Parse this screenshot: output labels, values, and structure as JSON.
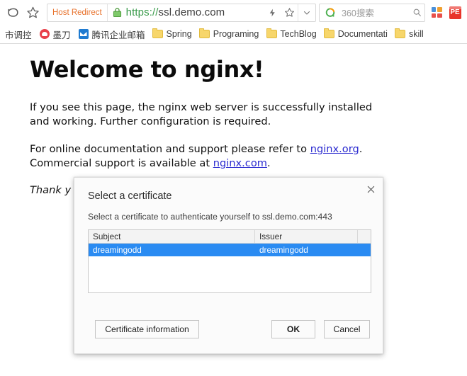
{
  "browser": {
    "toolbar": {
      "back_icon": "back-arrow-icon",
      "bookmark_star_icon": "star-icon",
      "host_redirect_badge": "Host Redirect",
      "lock_icon": "lock-icon",
      "url_scheme": "https://",
      "url_host": "ssl.demo.com",
      "lightning_icon": "lightning-bolt-icon",
      "star_icon": "star-outline-icon",
      "chevron_icon": "chevron-down-icon",
      "search_engine_icon": "360-search-icon",
      "search_placeholder": "360搜索",
      "search_go_icon": "search-icon",
      "ext_grid_icon": "apps-grid-icon",
      "ext_pe_label": "PE"
    },
    "bookmarks": [
      {
        "label": "市调控",
        "icon": "none"
      },
      {
        "label": "墨刀",
        "icon": "modao-icon"
      },
      {
        "label": "腾讯企业邮箱",
        "icon": "tencent-mail-icon"
      },
      {
        "label": "Spring",
        "icon": "folder-icon"
      },
      {
        "label": "Programing",
        "icon": "folder-icon"
      },
      {
        "label": "TechBlog",
        "icon": "folder-icon"
      },
      {
        "label": "Documentati",
        "icon": "folder-icon"
      },
      {
        "label": "skill",
        "icon": "folder-icon"
      }
    ]
  },
  "page": {
    "heading": "Welcome to nginx!",
    "para1": "If you see this page, the nginx web server is successfully installed and working. Further configuration is required.",
    "para2_before": "For online documentation and support please refer to ",
    "para2_link": "nginx.org",
    "para2_middle": ". Commercial support is available at ",
    "para2_link2": "nginx.com",
    "para2_after": ".",
    "para3": "Thank y"
  },
  "dialog": {
    "title": "Select a certificate",
    "subtitle": "Select a certificate to authenticate yourself to ssl.demo.com:443",
    "close_icon": "close-icon",
    "columns": [
      "Subject",
      "Issuer",
      ""
    ],
    "rows": [
      {
        "subject": "dreamingodd",
        "issuer": "dreamingodd",
        "extra": "",
        "selected": true
      }
    ],
    "buttons": {
      "cert_info": "Certificate information",
      "ok": "OK",
      "cancel": "Cancel"
    },
    "selection_color": "#2a8bf2"
  }
}
